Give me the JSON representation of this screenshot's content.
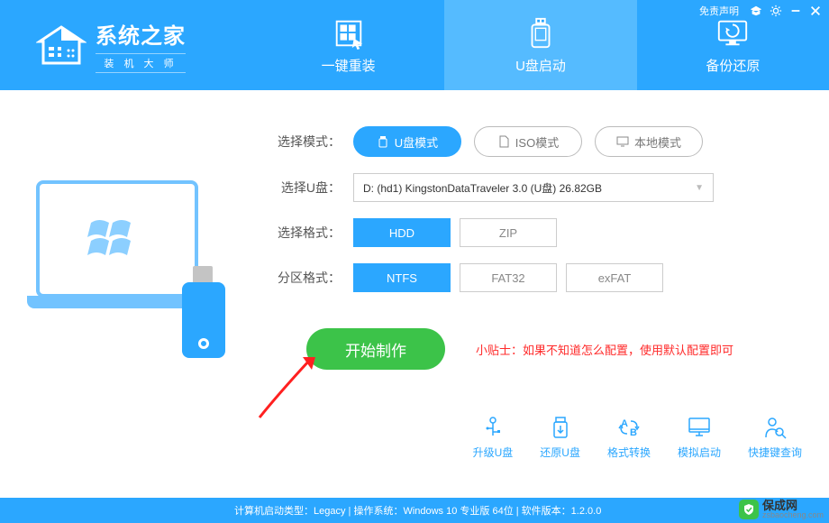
{
  "topbar": {
    "disclaimer": "免责声明"
  },
  "logo": {
    "title": "系统之家",
    "sub": "装 机 大 师"
  },
  "tabs": [
    {
      "label": "一键重装",
      "active": false
    },
    {
      "label": "U盘启动",
      "active": true
    },
    {
      "label": "备份还原",
      "active": false
    }
  ],
  "form": {
    "mode_label": "选择模式：",
    "modes": [
      {
        "label": "U盘模式",
        "active": true
      },
      {
        "label": "ISO模式",
        "active": false
      },
      {
        "label": "本地模式",
        "active": false
      }
    ],
    "usb_label": "选择U盘：",
    "usb_value": "D: (hd1) KingstonDataTraveler 3.0 (U盘) 26.82GB",
    "format_label": "选择格式：",
    "formats": [
      {
        "label": "HDD",
        "active": true
      },
      {
        "label": "ZIP",
        "active": false
      }
    ],
    "partition_label": "分区格式：",
    "partitions": [
      {
        "label": "NTFS",
        "active": true
      },
      {
        "label": "FAT32",
        "active": false
      },
      {
        "label": "exFAT",
        "active": false
      }
    ],
    "start_button": "开始制作",
    "tip_label": "小贴士：",
    "tip_text": "如果不知道怎么配置，使用默认配置即可"
  },
  "tools": [
    {
      "label": "升级U盘"
    },
    {
      "label": "还原U盘"
    },
    {
      "label": "格式转换"
    },
    {
      "label": "模拟启动"
    },
    {
      "label": "快捷键查询"
    }
  ],
  "footer": {
    "text": "计算机启动类型：Legacy | 操作系统：Windows 10 专业版 64位 | 软件版本：1.2.0.0"
  },
  "watermark": {
    "cn": "保成网",
    "url": "zsbaocheng.com"
  }
}
